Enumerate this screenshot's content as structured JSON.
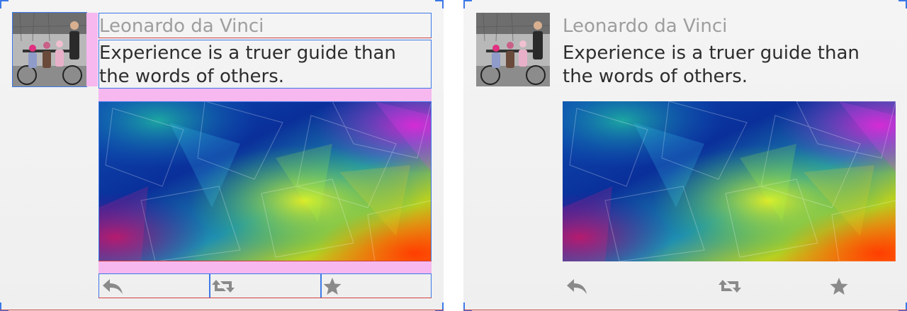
{
  "tweet": {
    "author_name": "Leonardo da Vinci",
    "text": "Experience is a truer guide than the words of others.",
    "avatar_image": "tandem-bicycle-kids-photo",
    "media_image": "abstract-polygon-colorful-art"
  },
  "actions": [
    {
      "name": "reply",
      "icon": "reply-icon"
    },
    {
      "name": "retweet",
      "icon": "retweet-icon"
    },
    {
      "name": "favorite",
      "icon": "star-icon"
    }
  ],
  "colors": {
    "layout_bounds_blue": "#3b78e7",
    "margin_pink": "#f6b8ef",
    "padding_red": "#d04040",
    "author_gray": "#9e9e9e",
    "text_dark": "#2d2d2d",
    "icon_gray": "#8a8a8a"
  }
}
